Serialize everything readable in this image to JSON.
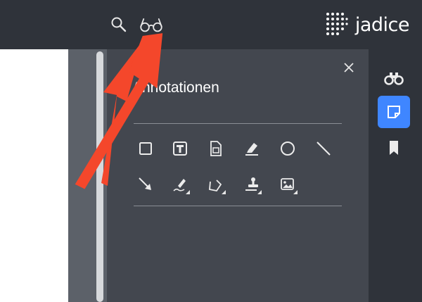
{
  "brand": {
    "name": "jadice"
  },
  "toolbar": {
    "icons": [
      "search-icon",
      "glasses-icon"
    ]
  },
  "panel": {
    "title": "Annotationen",
    "close_icon": "close-icon",
    "tools_row1": [
      "rectangle-icon",
      "text-box-icon",
      "note-icon",
      "highlighter-icon",
      "circle-icon",
      "line-icon"
    ],
    "tools_row2": [
      "arrow-icon",
      "freehand-pen-icon",
      "polyline-icon",
      "stamp-icon",
      "image-icon"
    ]
  },
  "sidebar": {
    "items": [
      {
        "icon": "binoculars-icon",
        "active": false
      },
      {
        "icon": "annotation-note-icon",
        "active": true
      },
      {
        "icon": "bookmark-icon",
        "active": false
      }
    ]
  },
  "colors": {
    "topbar": "#2f333a",
    "panel": "#43474f",
    "accent": "#3f86ff",
    "callout_arrow": "#f4472b"
  }
}
